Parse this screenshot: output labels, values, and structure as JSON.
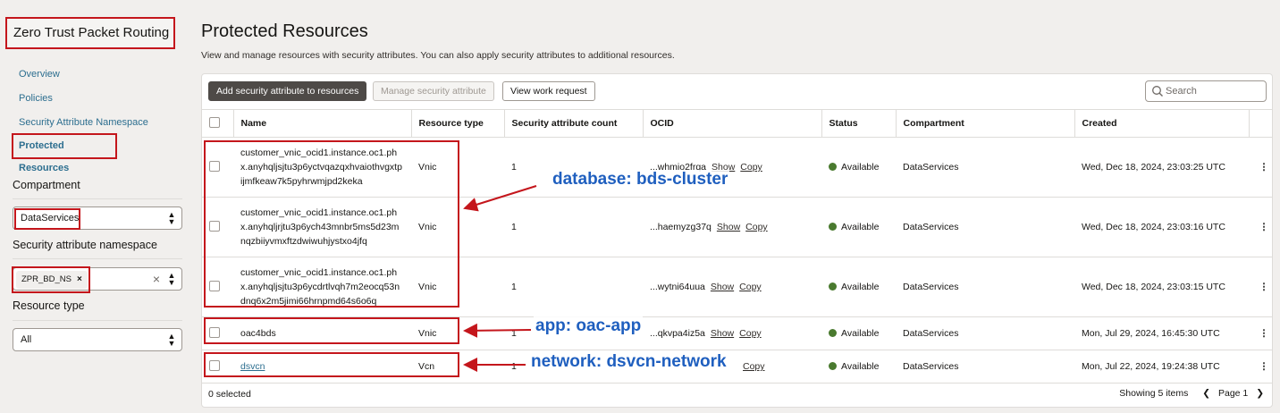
{
  "sidebar": {
    "title": "Zero Trust Packet Routing",
    "nav": [
      "Overview",
      "Policies",
      "Security Attribute Namespace"
    ],
    "nav_active": "Protected Resources",
    "compartment": {
      "label": "Compartment",
      "value": "DataServices"
    },
    "namespace": {
      "label": "Security attribute namespace",
      "chip": "ZPR_BD_NS"
    },
    "resource_type": {
      "label": "Resource type",
      "value": "All"
    }
  },
  "main": {
    "title": "Protected Resources",
    "description": "View and manage resources with security attributes. You can also apply security attributes to additional resources.",
    "buttons": {
      "add": "Add security attribute to resources",
      "manage": "Manage security attribute",
      "view": "View work request"
    },
    "search": {
      "placeholder": "Search"
    },
    "columns": [
      "Name",
      "Resource type",
      "Security attribute count",
      "OCID",
      "Status",
      "Compartment",
      "Created"
    ],
    "rows": [
      {
        "name": "customer_vnic_ocid1.instance.oc1.phx.anyhqljsjtu3p6yctvqazqxhvaiothvgxtpijmfkeaw7k5pyhrwmjpd2keka",
        "type": "Vnic",
        "count": "1",
        "ocid": "...whmio2frqa",
        "show": "Show",
        "copy": "Copy",
        "status": "Available",
        "compartment": "DataServices",
        "created": "Wed, Dec 18, 2024, 23:03:25 UTC"
      },
      {
        "name": "customer_vnic_ocid1.instance.oc1.phx.anyhqljrjtu3p6ych43mnbr5ms5d23mnqzbiiyvmxftzdwiwuhjystxo4jfq",
        "type": "Vnic",
        "count": "1",
        "ocid": "...haemyzg37q",
        "show": "Show",
        "copy": "Copy",
        "status": "Available",
        "compartment": "DataServices",
        "created": "Wed, Dec 18, 2024, 23:03:16 UTC"
      },
      {
        "name": "customer_vnic_ocid1.instance.oc1.phx.anyhqljsjtu3p6ycdrtlvqh7m2eocq53ndnq6x2m5jimi66hrnpmd64s6o6q",
        "type": "Vnic",
        "count": "1",
        "ocid": "...wytni64uua",
        "show": "Show",
        "copy": "Copy",
        "status": "Available",
        "compartment": "DataServices",
        "created": "Wed, Dec 18, 2024, 23:03:15 UTC"
      },
      {
        "name": "oac4bds",
        "type": "Vnic",
        "count": "1",
        "ocid": "...qkvpa4iz5a",
        "show": "Show",
        "copy": "Copy",
        "status": "Available",
        "compartment": "DataServices",
        "created": "Mon, Jul 29, 2024, 16:45:30 UTC"
      },
      {
        "name": "dsvcn",
        "type": "Vcn",
        "count": "1",
        "ocid": "",
        "show": "",
        "copy": "Copy",
        "status": "Available",
        "compartment": "DataServices",
        "created": "Mon, Jul 22, 2024, 19:24:38 UTC"
      }
    ],
    "footer": {
      "selected": "0 selected",
      "showing": "Showing 5 items",
      "page": "Page 1"
    }
  },
  "annotations": {
    "database": "database: bds-cluster",
    "app": "app: oac-app",
    "network": "network: dsvcn-network"
  },
  "colors": {
    "annotation": "#1f5fbf",
    "highlight": "#c4161c",
    "status_available": "#4a7a2f"
  }
}
